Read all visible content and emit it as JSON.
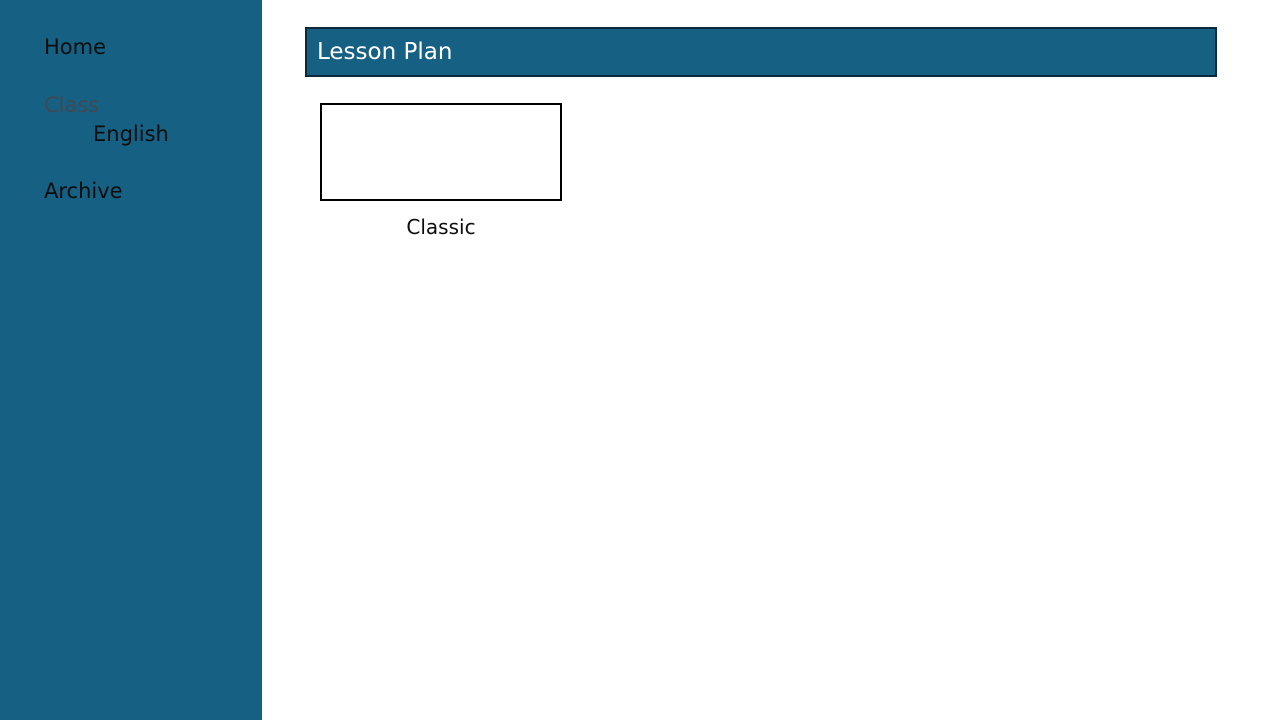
{
  "sidebar": {
    "items": [
      {
        "label": "Home"
      },
      {
        "label": "Class"
      },
      {
        "label": "English"
      },
      {
        "label": "Archive"
      }
    ]
  },
  "header": {
    "title": "Lesson Plan"
  },
  "templates": [
    {
      "label": "Classic"
    }
  ],
  "colors": {
    "accent": "#166083",
    "header_border": "#0e2a3a",
    "inactive_text": "#3f4a52",
    "text": "#0d0d0d",
    "background": "#ffffff"
  }
}
